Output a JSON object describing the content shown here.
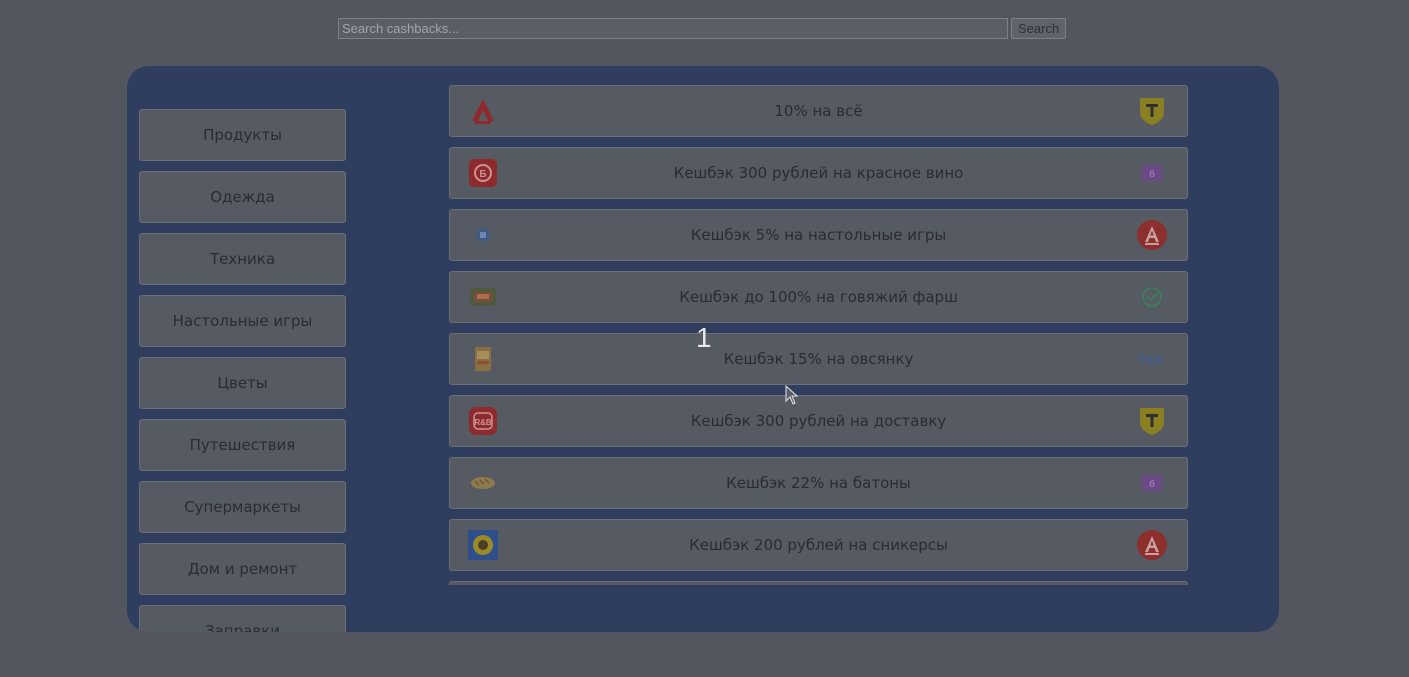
{
  "search": {
    "placeholder": "Search cashbacks...",
    "button_label": "Search"
  },
  "sidebar": {
    "items": [
      {
        "label": "Продукты"
      },
      {
        "label": "Одежда"
      },
      {
        "label": "Техника"
      },
      {
        "label": "Настольные игры"
      },
      {
        "label": "Цветы"
      },
      {
        "label": "Путешествия"
      },
      {
        "label": "Супермаркеты"
      },
      {
        "label": "Дом и ремонт"
      },
      {
        "label": "Заправки"
      }
    ]
  },
  "cashbacks": [
    {
      "text": "10% на всё",
      "shop_icon": "auchan-logo-icon",
      "bank_icon": "tinkoff-logo-icon"
    },
    {
      "text": "Кешбэк 300 рублей на красное вино",
      "shop_icon": "winelab-logo-icon",
      "bank_icon": "ozon-bank-logo-icon"
    },
    {
      "text": "Кешбэк 5% на настольные игры",
      "shop_icon": "boardgame-shop-logo-icon",
      "bank_icon": "alfa-bank-logo-icon"
    },
    {
      "text": "Кешбэк до 100% на говяжий фарш",
      "shop_icon": "minced-beef-package-icon",
      "bank_icon": "sber-logo-icon"
    },
    {
      "text": "Кешбэк 15% на овсянку",
      "shop_icon": "oatmeal-package-icon",
      "bank_icon": "vtb-logo-icon"
    },
    {
      "text": "Кешбэк 300 рублей на доставку",
      "shop_icon": "delivery-service-logo-icon",
      "bank_icon": "tinkoff-logo-icon"
    },
    {
      "text": "Кешбэк 22% на батоны",
      "shop_icon": "loaf-bread-icon",
      "bank_icon": "ozon-bank-logo-icon"
    },
    {
      "text": "Кешбэк 200 рублей на сникерсы",
      "shop_icon": "sunflower-logo-icon",
      "bank_icon": "alfa-bank-logo-icon"
    }
  ],
  "overlay": {
    "number": "1"
  },
  "colors": {
    "page_bg": "#53565f",
    "panel_bg": "#2f3d5f",
    "card_bg": "#565a63"
  }
}
